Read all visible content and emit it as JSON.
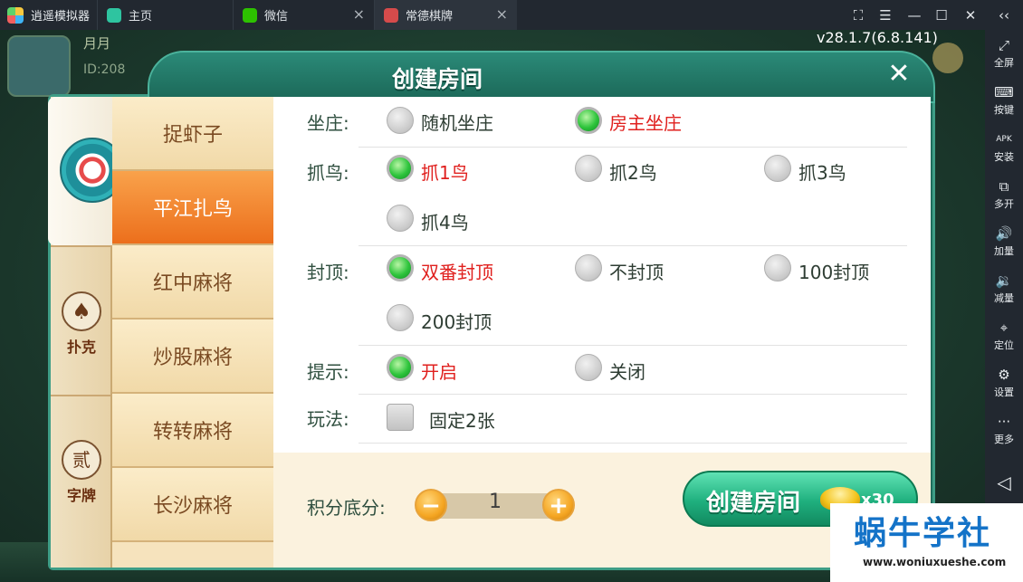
{
  "emulator": {
    "app_name": "逍遥模拟器",
    "tabs": [
      {
        "label": "主页"
      },
      {
        "label": "微信",
        "close": "×"
      },
      {
        "label": "常德棋牌",
        "close": "×"
      }
    ],
    "controls": {
      "capture": "⛶",
      "menu": "☰",
      "minimize": "—",
      "maximize": "☐",
      "close": "✕",
      "collapse": "‹‹"
    }
  },
  "sidebar": {
    "items": [
      {
        "label": "全屏",
        "icon": "⤢"
      },
      {
        "label": "按键",
        "icon": "⌨"
      },
      {
        "label": "安装",
        "icon": "APK"
      },
      {
        "label": "多开",
        "icon": "⧉"
      },
      {
        "label": "加量",
        "icon": "🔊"
      },
      {
        "label": "减量",
        "icon": "🔉"
      },
      {
        "label": "定位",
        "icon": "⌖"
      },
      {
        "label": "设置",
        "icon": "⚙"
      },
      {
        "label": "更多",
        "icon": "···"
      }
    ],
    "back_icon": "◁"
  },
  "game": {
    "version": "v28.1.7(6.8.141)",
    "background": {
      "name": "月月",
      "id": "ID:208"
    }
  },
  "dialog": {
    "title": "创建房间",
    "close": "✕",
    "categories": [
      {
        "label": "",
        "icon": "mahjong-icon",
        "active": true
      },
      {
        "label": "扑克",
        "icon_glyph": "♠"
      },
      {
        "label": "字牌",
        "icon_glyph": "贰"
      }
    ],
    "games": [
      {
        "label": "捉虾子",
        "active": false
      },
      {
        "label": "平江扎鸟",
        "active": true
      },
      {
        "label": "红中麻将",
        "active": false
      },
      {
        "label": "炒股麻将",
        "active": false
      },
      {
        "label": "转转麻将",
        "active": false
      },
      {
        "label": "长沙麻将",
        "active": false
      }
    ],
    "options": {
      "dealer": {
        "label": "坐庄:",
        "choices": [
          {
            "text": "随机坐庄",
            "selected": false
          },
          {
            "text": "房主坐庄",
            "selected": true
          }
        ]
      },
      "bird": {
        "label": "抓鸟:",
        "choices": [
          {
            "text": "抓1鸟",
            "selected": true
          },
          {
            "text": "抓2鸟",
            "selected": false
          },
          {
            "text": "抓3鸟",
            "selected": false
          },
          {
            "text": "抓4鸟",
            "selected": false
          }
        ]
      },
      "cap": {
        "label": "封顶:",
        "choices": [
          {
            "text": "双番封顶",
            "selected": true
          },
          {
            "text": "不封顶",
            "selected": false
          },
          {
            "text": "100封顶",
            "selected": false
          },
          {
            "text": "200封顶",
            "selected": false
          }
        ]
      },
      "hint": {
        "label": "提示:",
        "choices": [
          {
            "text": "开启",
            "selected": true
          },
          {
            "text": "关闭",
            "selected": false
          }
        ]
      },
      "play": {
        "label": "玩法:",
        "checkbox": {
          "text": "固定2张",
          "checked": false
        }
      }
    },
    "score": {
      "label": "积分底分:",
      "value": "1",
      "minus": "−",
      "plus": "+"
    },
    "create": {
      "label": "创建房间",
      "cost": "x30"
    }
  },
  "watermark": {
    "title": "蜗牛学社",
    "url": "www.woniuxueshe.com"
  },
  "colors": {
    "accent_green": "#1fb07e",
    "selected_red": "#e0201e",
    "tab_orange": "#ec6f1c",
    "frame_teal": "#1f6d5c"
  }
}
